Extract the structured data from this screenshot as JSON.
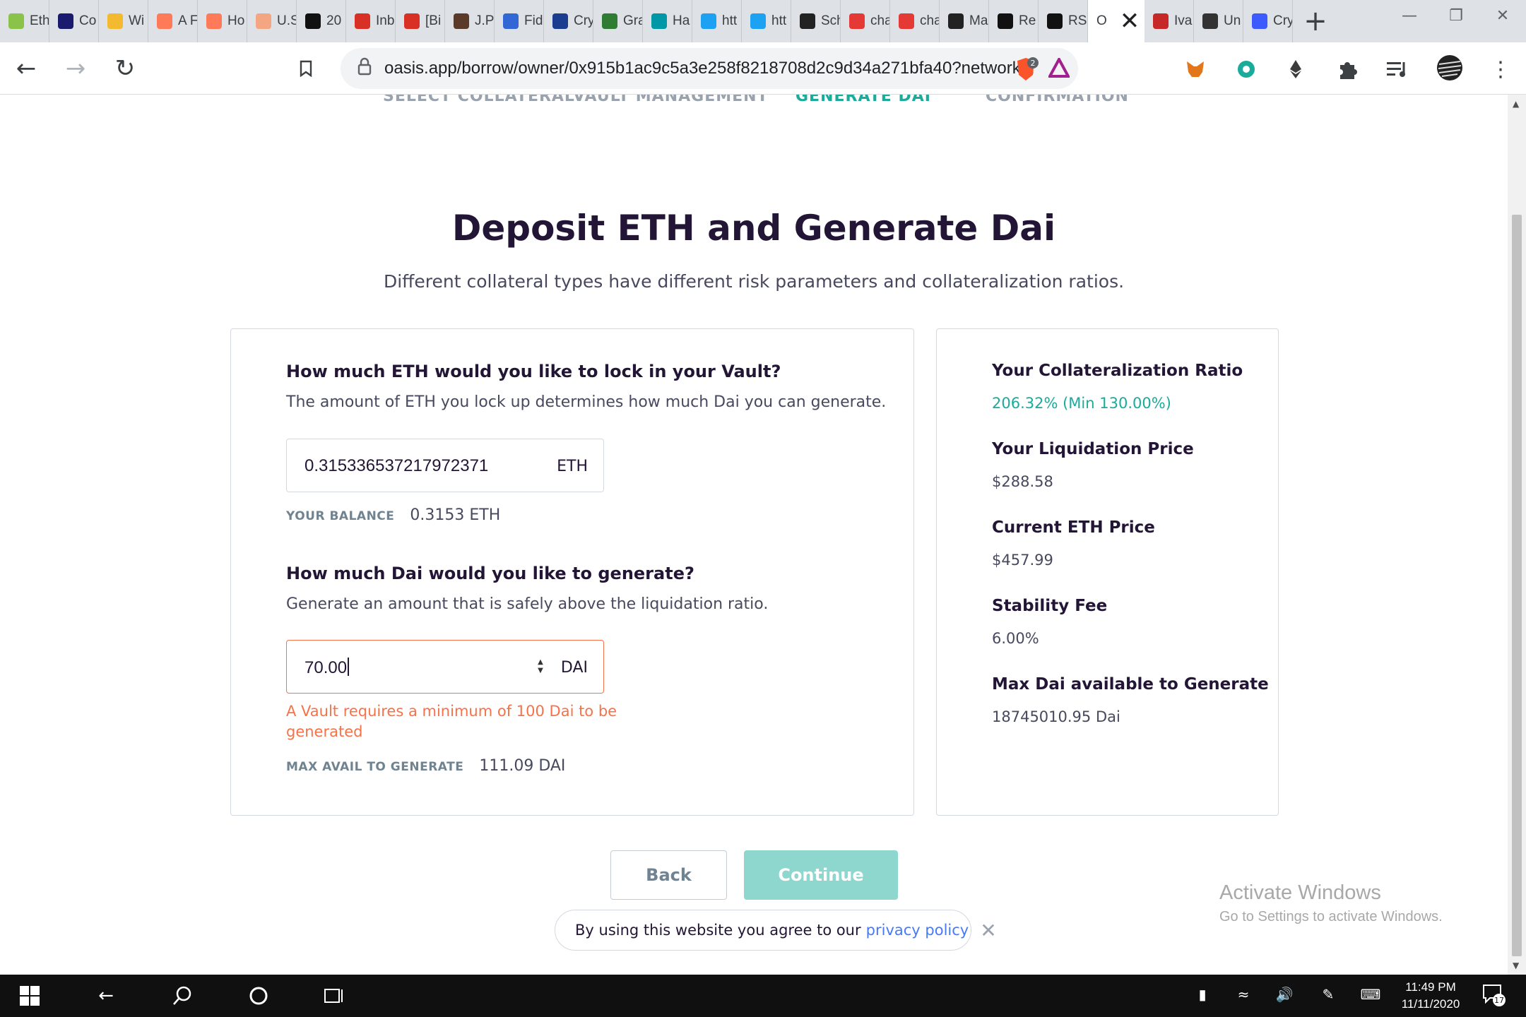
{
  "browser": {
    "tabs": [
      {
        "label": "Eth",
        "color": "#8bc34a"
      },
      {
        "label": "Co",
        "color": "#1a1a6e"
      },
      {
        "label": "Wi",
        "color": "#f3ba2f"
      },
      {
        "label": "A F",
        "color": "#ff7a59"
      },
      {
        "label": "Ho",
        "color": "#ff7a59"
      },
      {
        "label": "U.S",
        "color": "#f4a582"
      },
      {
        "label": "20",
        "color": "#111111"
      },
      {
        "label": "Inb",
        "color": "#d93025"
      },
      {
        "label": "[Bi",
        "color": "#d93025"
      },
      {
        "label": "J.P",
        "color": "#5b3a29"
      },
      {
        "label": "Fid",
        "color": "#3367d6"
      },
      {
        "label": "Cry",
        "color": "#1a3d8f"
      },
      {
        "label": "Gra",
        "color": "#2e7d32"
      },
      {
        "label": "Ha",
        "color": "#0097a7"
      },
      {
        "label": "htt",
        "color": "#1da1f2"
      },
      {
        "label": "htt",
        "color": "#1da1f2"
      },
      {
        "label": "Sch",
        "color": "#222222"
      },
      {
        "label": "cha",
        "color": "#e53935"
      },
      {
        "label": "cha",
        "color": "#e53935"
      },
      {
        "label": "Ma",
        "color": "#222222"
      },
      {
        "label": "Re",
        "color": "#111111"
      },
      {
        "label": "RS",
        "color": "#111111"
      }
    ],
    "active_tab_label": "O",
    "tabs_after": [
      {
        "label": "Iva",
        "color": "#c62828"
      },
      {
        "label": "Un",
        "color": "#333333"
      },
      {
        "label": "Cry",
        "color": "#3d5afe"
      }
    ],
    "new_tab": "+",
    "url": "oasis.app/borrow/owner/0x915b1ac9c5a3e258f8218708d2c9d34a271bfa40?network...",
    "brave_badge": "2"
  },
  "steps": {
    "select_collateral": "SELECT COLLATERAL",
    "vault_management": "VAULT MANAGEMENT",
    "generate_dai": "GENERATE DAI",
    "confirmation": "CONFIRMATION"
  },
  "header": {
    "title": "Deposit ETH and Generate Dai",
    "subtitle": "Different collateral types have different risk parameters and collateralization ratios."
  },
  "lock": {
    "question": "How much ETH would you like to lock in your Vault?",
    "description": "The amount of ETH you lock up determines how much Dai you can generate.",
    "value": "0.315336537217972371",
    "unit": "ETH",
    "balance_label": "YOUR BALANCE",
    "balance_value": "0.3153 ETH"
  },
  "generate": {
    "question": "How much Dai would you like to generate?",
    "description": "Generate an amount that is safely above the liquidation ratio.",
    "value": "70.00",
    "unit": "DAI",
    "error": "A Vault requires a minimum of 100 Dai to be generated",
    "max_label": "MAX AVAIL TO GENERATE",
    "max_value": "111.09 DAI"
  },
  "stats": {
    "ratio_label": "Your Collateralization Ratio",
    "ratio_value": "206.32% (Min 130.00%)",
    "liq_label": "Your Liquidation Price",
    "liq_value": "$288.58",
    "price_label": "Current ETH Price",
    "price_value": "$457.99",
    "fee_label": "Stability Fee",
    "fee_value": "6.00%",
    "max_label": "Max Dai available to Generate",
    "max_value": "18745010.95 Dai"
  },
  "actions": {
    "back": "Back",
    "continue": "Continue"
  },
  "cookie": {
    "text": "By using this website you agree to our",
    "link": "privacy policy"
  },
  "watermark": {
    "line1": "Activate Windows",
    "line2": "Go to Settings to activate Windows."
  },
  "taskbar": {
    "time": "11:49 PM",
    "date": "11/11/2020",
    "notifications": "17"
  },
  "colors": {
    "accent": "#1aab9b",
    "error": "#f77249",
    "continue_disabled": "#8ed7ce",
    "title": "#231536"
  }
}
